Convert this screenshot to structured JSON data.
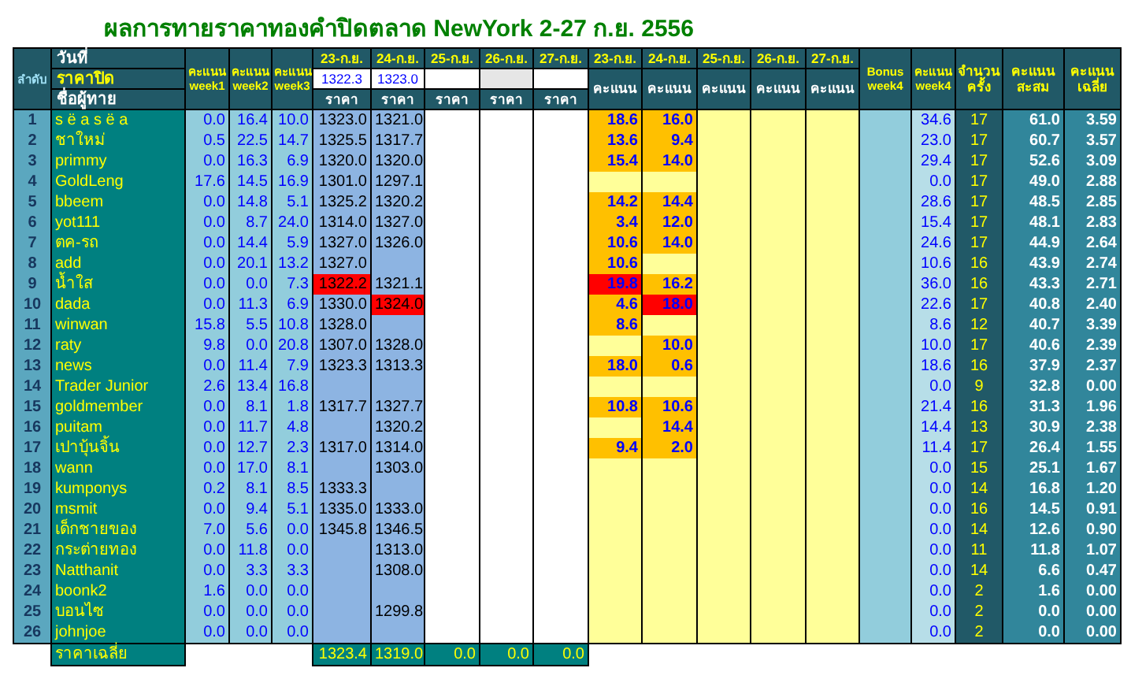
{
  "title": "ผลการทายราคาทองคำปิดตลาด NewYork 2-27 ก.ย. 2556",
  "header": {
    "rank": "ลำดับ",
    "date_label": "วันที่",
    "close_label": "ราคาปิด",
    "name_label": "ชื่อผู้ทาย",
    "weeks": [
      "คะแนน week1",
      "คะแนน week2",
      "คะแนน week3"
    ],
    "days": [
      {
        "date": "23-ก.ย.",
        "close": "1322.3",
        "shaded": false,
        "price_label": "ราคา"
      },
      {
        "date": "24-ก.ย.",
        "close": "1323.0",
        "shaded": false,
        "price_label": "ราคา"
      },
      {
        "date": "25-ก.ย.",
        "shaded": false,
        "price_label": "ราคา"
      },
      {
        "date": "26-ก.ย.",
        "shaded": true,
        "price_label": "ราคา"
      },
      {
        "date": "27-ก.ย.",
        "shaded": false,
        "price_label": "ราคา"
      }
    ],
    "score_days": [
      {
        "date": "23-ก.ย.",
        "label": "คะแนน"
      },
      {
        "date": "24-ก.ย.",
        "label": "คะแนน"
      },
      {
        "date": "25-ก.ย.",
        "label": "คะแนน"
      },
      {
        "date": "26-ก.ย.",
        "label": "คะแนน"
      },
      {
        "date": "27-ก.ย.",
        "label": "คะแนน"
      }
    ],
    "bonus": "Bonus week4",
    "week4": "คะแนน week4",
    "count": "จำนวนครั้ง",
    "total": "คะแนนสะสม",
    "average": "คะแนนเฉลี่ย"
  },
  "rows": [
    {
      "rank": "1",
      "name": "s ë a s ë a",
      "weeks": [
        "0.0",
        "16.4",
        "10.0"
      ],
      "days": [
        {
          "price": "1323.0",
          "score": "18.6",
          "best": false
        },
        {
          "price": "1321.0",
          "score": "16.0",
          "best": false
        }
      ],
      "week4": "34.6",
      "count": "17",
      "total": "61.0",
      "average": "3.59"
    },
    {
      "rank": "2",
      "name": "ชาใหม่",
      "weeks": [
        "0.5",
        "22.5",
        "14.7"
      ],
      "days": [
        {
          "price": "1325.5",
          "score": "13.6",
          "best": false
        },
        {
          "price": "1317.7",
          "score": "9.4",
          "best": false
        }
      ],
      "week4": "23.0",
      "count": "17",
      "total": "60.7",
      "average": "3.57"
    },
    {
      "rank": "3",
      "name": "primmy",
      "weeks": [
        "0.0",
        "16.3",
        "6.9"
      ],
      "days": [
        {
          "price": "1320.0",
          "score": "15.4",
          "best": false
        },
        {
          "price": "1320.0",
          "score": "14.0",
          "best": false
        }
      ],
      "week4": "29.4",
      "count": "17",
      "total": "52.6",
      "average": "3.09"
    },
    {
      "rank": "4",
      "name": "GoldLeng",
      "weeks": [
        "17.6",
        "14.5",
        "16.9"
      ],
      "days": [
        {
          "price": "1301.0",
          "best": false
        },
        {
          "price": "1297.1",
          "best": false
        }
      ],
      "week4": "0.0",
      "count": "17",
      "total": "49.0",
      "average": "2.88"
    },
    {
      "rank": "5",
      "name": "bbeem",
      "weeks": [
        "0.0",
        "14.8",
        "5.1"
      ],
      "days": [
        {
          "price": "1325.2",
          "score": "14.2",
          "best": false
        },
        {
          "price": "1320.2",
          "score": "14.4",
          "best": false
        }
      ],
      "week4": "28.6",
      "count": "17",
      "total": "48.5",
      "average": "2.85"
    },
    {
      "rank": "6",
      "name": "yot111",
      "weeks": [
        "0.0",
        "8.7",
        "24.0"
      ],
      "days": [
        {
          "price": "1314.0",
          "score": "3.4",
          "best": false
        },
        {
          "price": "1327.0",
          "score": "12.0",
          "best": false
        }
      ],
      "week4": "15.4",
      "count": "17",
      "total": "48.1",
      "average": "2.83"
    },
    {
      "rank": "7",
      "name": "ตค-รถ",
      "weeks": [
        "0.0",
        "14.4",
        "5.9"
      ],
      "days": [
        {
          "price": "1327.0",
          "score": "10.6",
          "best": false
        },
        {
          "price": "1326.0",
          "score": "14.0",
          "best": false
        }
      ],
      "week4": "24.6",
      "count": "17",
      "total": "44.9",
      "average": "2.64"
    },
    {
      "rank": "8",
      "name": "add",
      "weeks": [
        "0.0",
        "20.1",
        "13.2"
      ],
      "days": [
        {
          "price": "1327.0",
          "score": "10.6",
          "best": false
        },
        {
          "best": false
        }
      ],
      "week4": "10.6",
      "count": "16",
      "total": "43.9",
      "average": "2.74"
    },
    {
      "rank": "9",
      "name": "น้ำใส",
      "weeks": [
        "0.0",
        "0.0",
        "7.3"
      ],
      "days": [
        {
          "price": "1322.2",
          "score": "19.8",
          "best": true
        },
        {
          "price": "1321.1",
          "score": "16.2",
          "best": false
        }
      ],
      "week4": "36.0",
      "count": "16",
      "total": "43.3",
      "average": "2.71"
    },
    {
      "rank": "10",
      "name": "dada",
      "weeks": [
        "0.0",
        "11.3",
        "6.9"
      ],
      "days": [
        {
          "price": "1330.0",
          "score": "4.6",
          "best": false
        },
        {
          "price": "1324.0",
          "score": "18.0",
          "best": true
        }
      ],
      "week4": "22.6",
      "count": "17",
      "total": "40.8",
      "average": "2.40"
    },
    {
      "rank": "11",
      "name": "winwan",
      "weeks": [
        "15.8",
        "5.5",
        "10.8"
      ],
      "days": [
        {
          "price": "1328.0",
          "score": "8.6",
          "best": false
        },
        {
          "best": false
        }
      ],
      "week4": "8.6",
      "count": "12",
      "total": "40.7",
      "average": "3.39"
    },
    {
      "rank": "12",
      "name": "raty",
      "weeks": [
        "9.8",
        "0.0",
        "20.8"
      ],
      "days": [
        {
          "price": "1307.0",
          "best": false
        },
        {
          "price": "1328.0",
          "score": "10.0",
          "best": false
        }
      ],
      "week4": "10.0",
      "count": "17",
      "total": "40.6",
      "average": "2.39"
    },
    {
      "rank": "13",
      "name": "news",
      "weeks": [
        "0.0",
        "11.4",
        "7.9"
      ],
      "days": [
        {
          "price": "1323.3",
          "score": "18.0",
          "best": false
        },
        {
          "price": "1313.3",
          "score": "0.6",
          "best": false
        }
      ],
      "week4": "18.6",
      "count": "16",
      "total": "37.9",
      "average": "2.37"
    },
    {
      "rank": "14",
      "name": "Trader Junior",
      "weeks": [
        "2.6",
        "13.4",
        "16.8"
      ],
      "days": [
        {
          "best": false
        },
        {
          "best": false
        }
      ],
      "week4": "0.0",
      "count": "9",
      "total": "32.8",
      "average": "0.00"
    },
    {
      "rank": "15",
      "name": "goldmember",
      "weeks": [
        "0.0",
        "8.1",
        "1.8"
      ],
      "days": [
        {
          "price": "1317.7",
          "score": "10.8",
          "best": false
        },
        {
          "price": "1327.7",
          "score": "10.6",
          "best": false
        }
      ],
      "week4": "21.4",
      "count": "16",
      "total": "31.3",
      "average": "1.96"
    },
    {
      "rank": "16",
      "name": "puitam",
      "weeks": [
        "0.0",
        "11.7",
        "4.8"
      ],
      "days": [
        {
          "best": false
        },
        {
          "price": "1320.2",
          "score": "14.4",
          "best": false
        }
      ],
      "week4": "14.4",
      "count": "13",
      "total": "30.9",
      "average": "2.38"
    },
    {
      "rank": "17",
      "name": "เปาบุ้นจิ้น",
      "weeks": [
        "0.0",
        "12.7",
        "2.3"
      ],
      "days": [
        {
          "price": "1317.0",
          "score": "9.4",
          "best": false
        },
        {
          "price": "1314.0",
          "score": "2.0",
          "best": false
        }
      ],
      "week4": "11.4",
      "count": "17",
      "total": "26.4",
      "average": "1.55"
    },
    {
      "rank": "18",
      "name": "wann",
      "weeks": [
        "0.0",
        "17.0",
        "8.1"
      ],
      "days": [
        {
          "best": false
        },
        {
          "price": "1303.0",
          "best": false
        }
      ],
      "week4": "0.0",
      "count": "15",
      "total": "25.1",
      "average": "1.67"
    },
    {
      "rank": "19",
      "name": "kumponys",
      "weeks": [
        "0.2",
        "8.1",
        "8.5"
      ],
      "days": [
        {
          "price": "1333.3",
          "best": false
        },
        {
          "best": false
        }
      ],
      "week4": "0.0",
      "count": "14",
      "total": "16.8",
      "average": "1.20"
    },
    {
      "rank": "20",
      "name": "msmit",
      "weeks": [
        "0.0",
        "9.4",
        "5.1"
      ],
      "days": [
        {
          "price": "1335.0",
          "best": false
        },
        {
          "price": "1333.0",
          "best": false
        }
      ],
      "week4": "0.0",
      "count": "16",
      "total": "14.5",
      "average": "0.91"
    },
    {
      "rank": "21",
      "name": "เด็กชายของ",
      "weeks": [
        "7.0",
        "5.6",
        "0.0"
      ],
      "days": [
        {
          "price": "1345.8",
          "best": false
        },
        {
          "price": "1346.5",
          "best": false
        }
      ],
      "week4": "0.0",
      "count": "14",
      "total": "12.6",
      "average": "0.90"
    },
    {
      "rank": "22",
      "name": "กระต่ายทอง",
      "weeks": [
        "0.0",
        "11.8",
        "0.0"
      ],
      "days": [
        {
          "best": false
        },
        {
          "price": "1313.0",
          "best": false
        }
      ],
      "week4": "0.0",
      "count": "11",
      "total": "11.8",
      "average": "1.07"
    },
    {
      "rank": "23",
      "name": "Natthanit",
      "weeks": [
        "0.0",
        "3.3",
        "3.3"
      ],
      "days": [
        {
          "best": false
        },
        {
          "price": "1308.0",
          "best": false
        }
      ],
      "week4": "0.0",
      "count": "14",
      "total": "6.6",
      "average": "0.47"
    },
    {
      "rank": "24",
      "name": "boonk2",
      "weeks": [
        "1.6",
        "0.0",
        "0.0"
      ],
      "days": [
        {
          "best": false
        },
        {
          "best": false
        }
      ],
      "week4": "0.0",
      "count": "2",
      "total": "1.6",
      "average": "0.00"
    },
    {
      "rank": "25",
      "name": "บอนไซ",
      "weeks": [
        "0.0",
        "0.0",
        "0.0"
      ],
      "days": [
        {
          "best": false
        },
        {
          "price": "1299.8",
          "best": false
        }
      ],
      "week4": "0.0",
      "count": "2",
      "total": "0.0",
      "average": "0.00"
    },
    {
      "rank": "26",
      "name": "johnjoe",
      "weeks": [
        "0.0",
        "0.0",
        "0.0"
      ],
      "days": [
        {
          "best": false
        },
        {
          "best": false
        }
      ],
      "week4": "0.0",
      "count": "2",
      "total": "0.0",
      "average": "0.00"
    }
  ],
  "footer": {
    "label": "ราคาเฉลี่ย",
    "prices": [
      "1323.4",
      "1319.0",
      "0.0",
      "0.0",
      "0.0"
    ]
  }
}
